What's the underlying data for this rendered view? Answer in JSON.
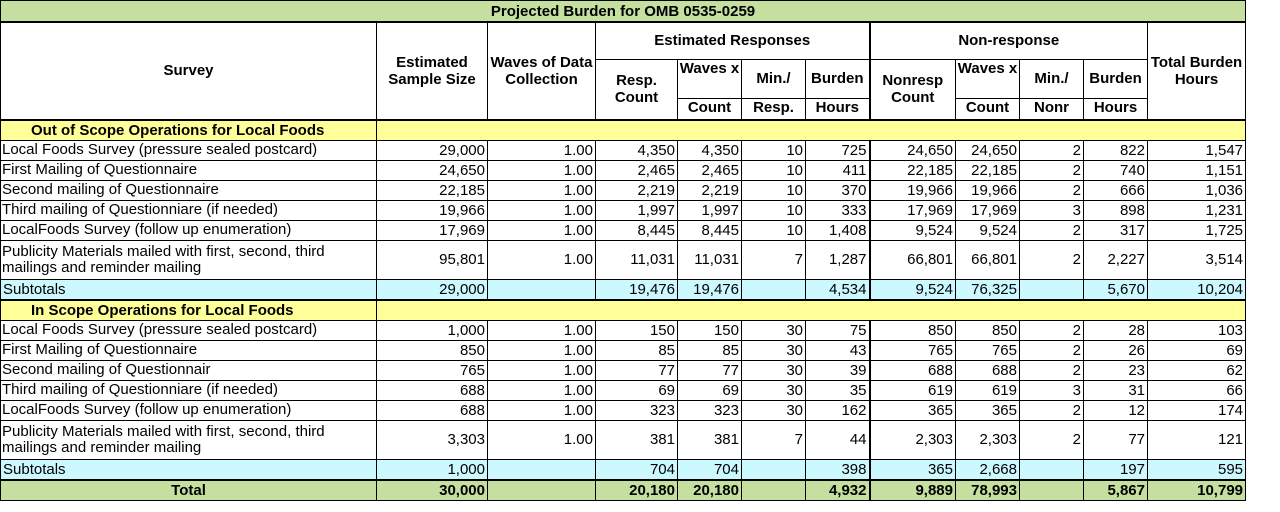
{
  "title": "Projected Burden for OMB 0535-0259",
  "headers": {
    "survey": "Survey",
    "sample_size": "Estimated Sample Size",
    "waves": "Waves of Data Collection",
    "est_responses": "Estimated Responses",
    "non_response": "Non-response",
    "total_burden": "Total Burden Hours",
    "resp_count": "Resp. Count",
    "waves_x_1": "Waves x",
    "count_1": "Count",
    "min_1": "Min./",
    "resp_1": "Resp.",
    "burden_1": "Burden",
    "hours_1": "Hours",
    "nonresp_count": "Nonresp Count",
    "waves_x_2": "Waves x",
    "count_2": "Count",
    "min_2": "Min./",
    "nonr_2": "Nonr",
    "burden_2": "Burden",
    "hours_2": "Hours"
  },
  "section1": {
    "label": "Out of Scope Operations for Local Foods",
    "rows": [
      [
        "Local Foods Survey (pressure sealed postcard)",
        "29,000",
        "1.00",
        "4,350",
        "4,350",
        "10",
        "725",
        "24,650",
        "24,650",
        "2",
        "822",
        "1,547"
      ],
      [
        "First Mailing of Questionnaire",
        "24,650",
        "1.00",
        "2,465",
        "2,465",
        "10",
        "411",
        "22,185",
        "22,185",
        "2",
        "740",
        "1,151"
      ],
      [
        "Second mailing of Questionnaire",
        "22,185",
        "1.00",
        "2,219",
        "2,219",
        "10",
        "370",
        "19,966",
        "19,966",
        "2",
        "666",
        "1,036"
      ],
      [
        "Third mailing of Questionniare (if needed)",
        "19,966",
        "1.00",
        "1,997",
        "1,997",
        "10",
        "333",
        "17,969",
        "17,969",
        "3",
        "898",
        "1,231"
      ],
      [
        "LocalFoods Survey (follow up enumeration)",
        "17,969",
        "1.00",
        "8,445",
        "8,445",
        "10",
        "1,408",
        "9,524",
        "9,524",
        "2",
        "317",
        "1,725"
      ],
      [
        "Publicity Materials mailed with first, second, third mailings and reminder mailing",
        "95,801",
        "1.00",
        "11,031",
        "11,031",
        "7",
        "1,287",
        "66,801",
        "66,801",
        "2",
        "2,227",
        "3,514"
      ]
    ],
    "subtotal": [
      "Subtotals",
      "29,000",
      "",
      "19,476",
      "19,476",
      "",
      "4,534",
      "9,524",
      "76,325",
      "",
      "5,670",
      "10,204"
    ]
  },
  "section2": {
    "label": "In Scope Operations for Local Foods",
    "rows": [
      [
        "Local Foods Survey (pressure sealed postcard)",
        "1,000",
        "1.00",
        "150",
        "150",
        "30",
        "75",
        "850",
        "850",
        "2",
        "28",
        "103"
      ],
      [
        "First Mailing of Questionnaire",
        "850",
        "1.00",
        "85",
        "85",
        "30",
        "43",
        "765",
        "765",
        "2",
        "26",
        "69"
      ],
      [
        "Second mailing of Questionnair",
        "765",
        "1.00",
        "77",
        "77",
        "30",
        "39",
        "688",
        "688",
        "2",
        "23",
        "62"
      ],
      [
        "Third mailing of Questionniare (if needed)",
        "688",
        "1.00",
        "69",
        "69",
        "30",
        "35",
        "619",
        "619",
        "3",
        "31",
        "66"
      ],
      [
        "LocalFoods Survey (follow up enumeration)",
        "688",
        "1.00",
        "323",
        "323",
        "30",
        "162",
        "365",
        "365",
        "2",
        "12",
        "174"
      ],
      [
        "Publicity Materials mailed with first, second, third mailings and reminder mailing",
        "3,303",
        "1.00",
        "381",
        "381",
        "7",
        "44",
        "2,303",
        "2,303",
        "2",
        "77",
        "121"
      ]
    ],
    "subtotal": [
      "Subtotals",
      "1,000",
      "",
      "704",
      "704",
      "",
      "398",
      "365",
      "2,668",
      "",
      "197",
      "595"
    ]
  },
  "total": [
    "Total",
    "30,000",
    "",
    "20,180",
    "20,180",
    "",
    "4,932",
    "9,889",
    "78,993",
    "",
    "5,867",
    "10,799"
  ]
}
